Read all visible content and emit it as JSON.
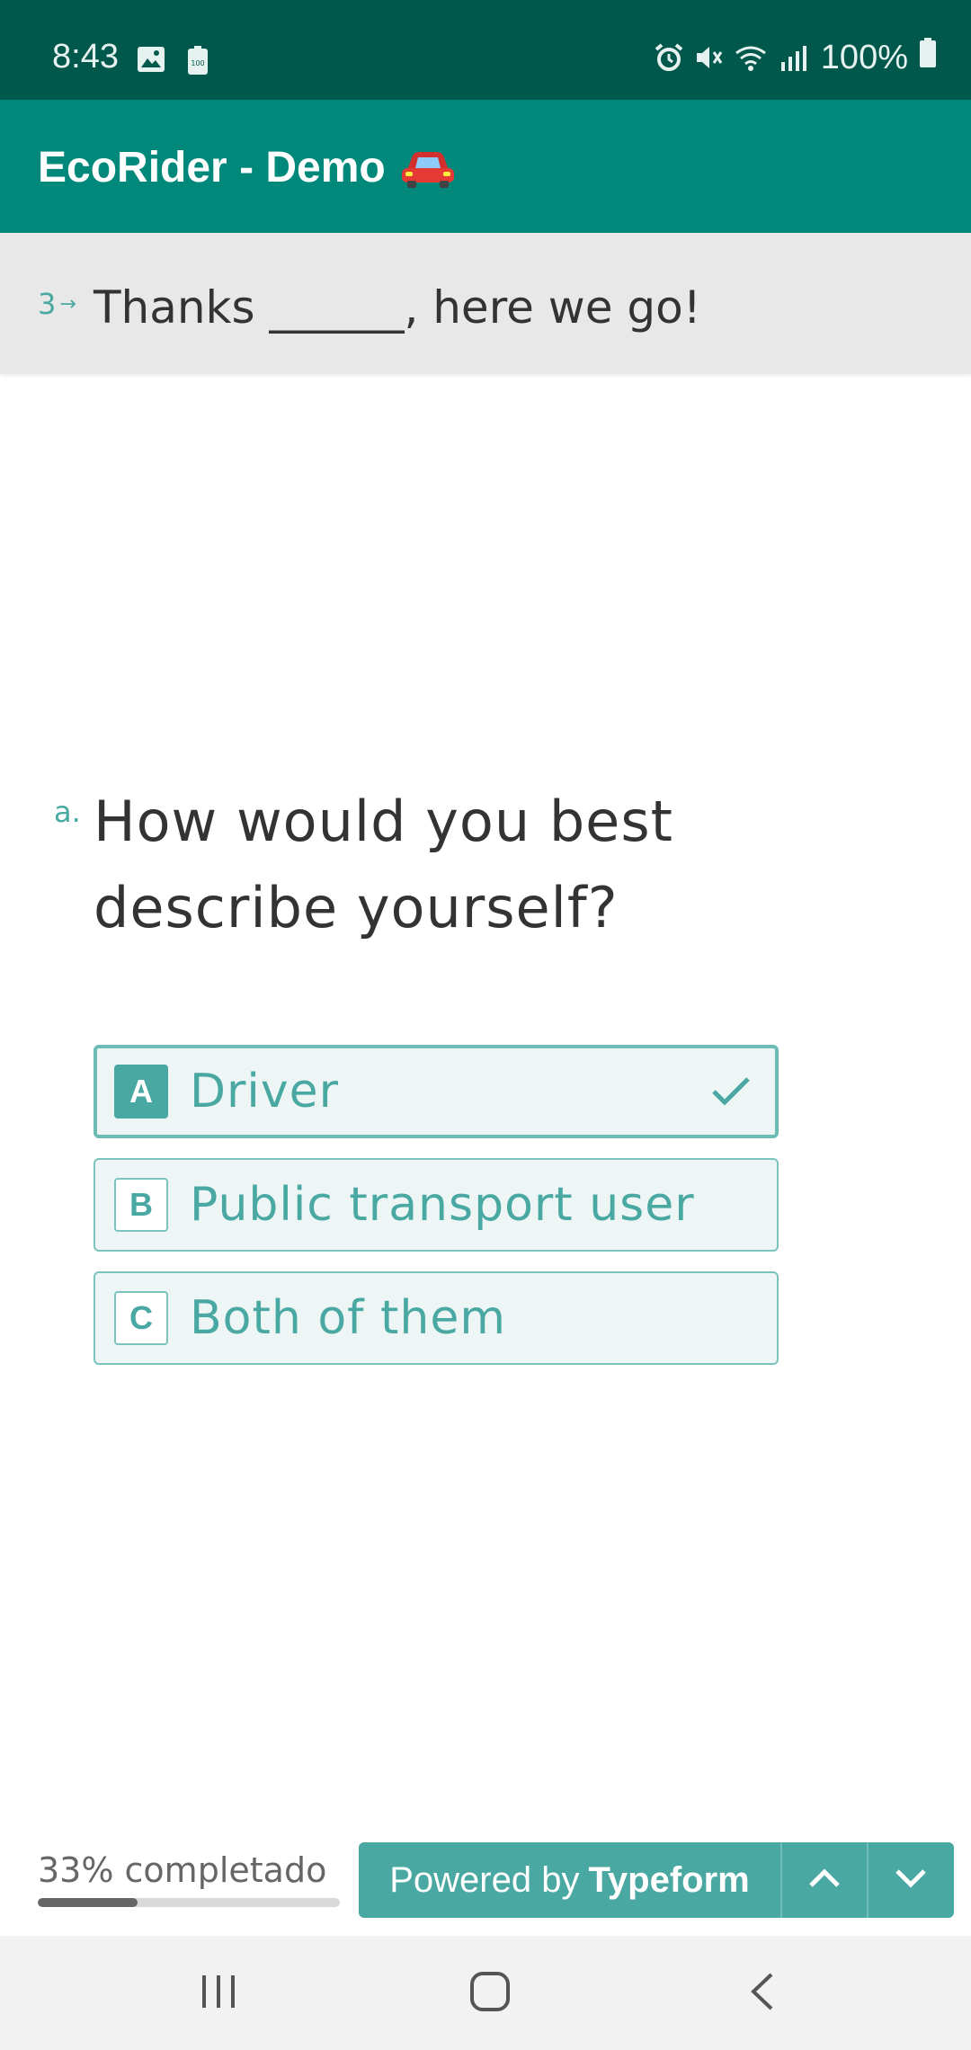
{
  "status_bar": {
    "time": "8:43",
    "battery_text": "100%",
    "left_icons": [
      "image-icon",
      "battery-saver-icon"
    ],
    "right_icons": [
      "alarm-icon",
      "mute-icon",
      "wifi-icon",
      "signal-icon",
      "battery-icon"
    ]
  },
  "app_bar": {
    "title": "EcoRider - Demo",
    "title_icon": "red-car-icon",
    "color": "#00897b"
  },
  "header": {
    "number": "3",
    "arrow": "→",
    "text": "Thanks ______, here we go!"
  },
  "question": {
    "letter": "a.",
    "text": "How would you best describe yourself?"
  },
  "choices": [
    {
      "key": "A",
      "label": "Driver",
      "selected": true
    },
    {
      "key": "B",
      "label": "Public transport user",
      "selected": false
    },
    {
      "key": "C",
      "label": "Both of them",
      "selected": false
    }
  ],
  "footer": {
    "progress_label": "33% completado",
    "progress_fraction": 0.33,
    "powered_prefix": "Powered by",
    "powered_brand": "Typeform",
    "accent_color": "#4aa8a2"
  },
  "system_nav": {
    "buttons": [
      "recent-apps-icon",
      "home-icon",
      "back-icon"
    ]
  }
}
